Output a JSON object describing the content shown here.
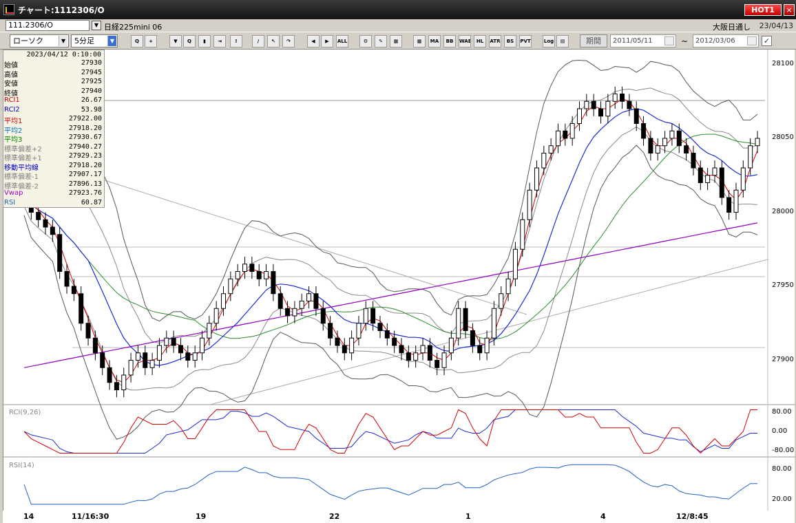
{
  "window": {
    "title": "チャート:1112306/O",
    "hot_label": "HOT1",
    "close_label": "×"
  },
  "info": {
    "symbol_code": "111.2306/O",
    "symbol_name": "日経225mini 06",
    "market": "大阪日通し",
    "date": "23/04/13"
  },
  "toolbar": {
    "chart_type": "ローソク",
    "interval": "5分足",
    "period_label": "期間",
    "date_from": "2011/05/11",
    "date_to": "2012/03/06",
    "tilde": "~",
    "buttons": [
      {
        "name": "zoom-icon",
        "label": "Q"
      },
      {
        "name": "crosshair-icon",
        "label": "+"
      },
      {
        "name": "draw-tool-icon",
        "label": "▼"
      },
      {
        "name": "lens-icon",
        "label": "Q"
      },
      {
        "name": "bar-icon",
        "label": "▮"
      },
      {
        "name": "exit-icon",
        "label": "⇥"
      },
      {
        "name": "warning-icon",
        "label": "!"
      },
      {
        "name": "pen-icon",
        "label": "/"
      },
      {
        "name": "pointer-icon",
        "label": "↖"
      },
      {
        "name": "redo-icon",
        "label": "↷"
      },
      {
        "name": "step-left-icon",
        "label": "◀"
      },
      {
        "name": "step-right-icon",
        "label": "▶"
      },
      {
        "name": "all-icon",
        "label": "ALL"
      },
      {
        "name": "settings-icon",
        "label": "⚙"
      },
      {
        "name": "tools-icon",
        "label": "✎"
      },
      {
        "name": "color-icon",
        "label": "▦"
      },
      {
        "name": "grid-icon",
        "label": "▦"
      },
      {
        "name": "ma-icon",
        "label": "MA"
      },
      {
        "name": "bb-icon",
        "label": "BB"
      },
      {
        "name": "wae-icon",
        "label": "WAE"
      },
      {
        "name": "hl-icon",
        "label": "HL"
      },
      {
        "name": "atr-icon",
        "label": "ATR"
      },
      {
        "name": "bs-icon",
        "label": "BS"
      },
      {
        "name": "pvt-icon",
        "label": "PVT"
      },
      {
        "name": "log-icon",
        "label": "Log"
      },
      {
        "name": "export-icon",
        "label": "▤"
      }
    ],
    "check_mark": "✓"
  },
  "panel": {
    "datetime": "2023/04/12 0:10:00",
    "rows": [
      {
        "label": "始値",
        "value": "27930",
        "color": "#000000"
      },
      {
        "label": "高値",
        "value": "27945",
        "color": "#000000"
      },
      {
        "label": "安値",
        "value": "27925",
        "color": "#000000"
      },
      {
        "label": "終値",
        "value": "27940",
        "color": "#000000"
      },
      {
        "label": "RCI1",
        "value": "26.67",
        "color": "#d00000"
      },
      {
        "label": "RCI2",
        "value": "53.98",
        "color": "#0000c0"
      },
      {
        "label": "平均1",
        "value": "27922.00",
        "color": "#d00000"
      },
      {
        "label": "平均2",
        "value": "27918.20",
        "color": "#0070c0"
      },
      {
        "label": "平均3",
        "value": "27930.67",
        "color": "#008000"
      },
      {
        "label": "標準偏差+2",
        "value": "27940.27",
        "color": "#808080"
      },
      {
        "label": "標準偏差+1",
        "value": "27929.23",
        "color": "#808080"
      },
      {
        "label": "移動平均線",
        "value": "27918.20",
        "color": "#0000c0"
      },
      {
        "label": "標準偏差-1",
        "value": "27907.17",
        "color": "#808080"
      },
      {
        "label": "標準偏差-2",
        "value": "27896.13",
        "color": "#808080"
      },
      {
        "label": "Vwap",
        "value": "27923.76",
        "color": "#a000c0"
      },
      {
        "label": "RSI",
        "value": "60.87",
        "color": "#2060c0"
      }
    ]
  },
  "price_axis": [
    "28100",
    "28050",
    "28000",
    "27950",
    "27900"
  ],
  "rci": {
    "title": "RCI(9,26)",
    "ticks": [
      "80.00",
      "0.00",
      "-80.00"
    ]
  },
  "rsi": {
    "title": "RSI(14)",
    "ticks": [
      "80.00",
      "20.00"
    ]
  },
  "x_axis": [
    "14",
    "11/16:30",
    "19",
    "22",
    "1",
    "4",
    "12/8:45"
  ],
  "chart_data": {
    "type": "candlestick",
    "ylim": [
      27870,
      28110
    ],
    "close": [
      28010,
      28000,
      27995,
      27990,
      27985,
      27960,
      27950,
      27945,
      27925,
      27915,
      27905,
      27895,
      27885,
      27880,
      27890,
      27900,
      27905,
      27895,
      27900,
      27910,
      27915,
      27910,
      27905,
      27900,
      27905,
      27915,
      27925,
      27935,
      27945,
      27955,
      27960,
      27965,
      27960,
      27955,
      27960,
      27945,
      27935,
      27930,
      27935,
      27940,
      27945,
      27935,
      27925,
      27915,
      27910,
      27905,
      27915,
      27925,
      27935,
      27925,
      27920,
      27915,
      27910,
      27905,
      27900,
      27905,
      27910,
      27900,
      27895,
      27905,
      27915,
      27935,
      27920,
      27910,
      27905,
      27915,
      27935,
      27945,
      27955,
      27975,
      27995,
      28015,
      28030,
      28040,
      28045,
      28055,
      28050,
      28060,
      28070,
      28075,
      28070,
      28065,
      28075,
      28080,
      28075,
      28070,
      28060,
      28050,
      28040,
      28045,
      28050,
      28055,
      28045,
      28040,
      28030,
      28020,
      28025,
      28030,
      28010,
      28000,
      28015,
      28030,
      28045,
      28050
    ]
  }
}
